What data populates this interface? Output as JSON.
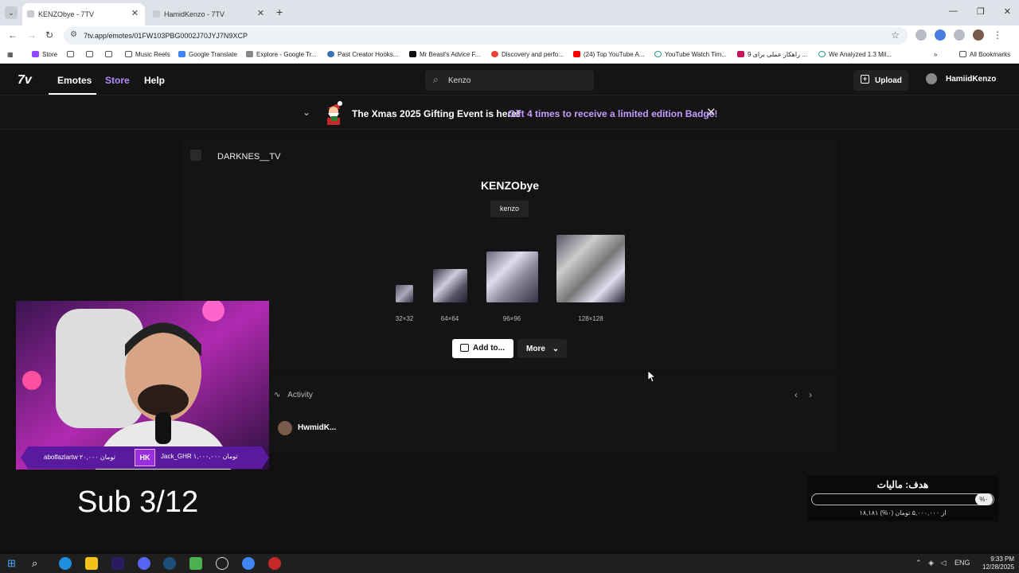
{
  "browser": {
    "tabs": [
      {
        "title": "KENZObye - 7TV",
        "active": true
      },
      {
        "title": "HamidKenzo - 7TV",
        "active": false
      }
    ],
    "url": "7tv.app/emotes/01FW103PBG0002J70JYJ7N9XCP",
    "bookmarks": [
      "Store",
      "",
      "",
      "Music Reels",
      "Google Translate",
      "Explore - Google Tr...",
      "Past Creator Hooks...",
      "Mr Beast's Advice F...",
      "Discovery and perfo...",
      "(24) Top YouTube A...",
      "YouTube Watch Tim...",
      "9 راهکار عملی برای ...",
      "We Analyzed 1.3 Mil...",
      "All Bookmarks"
    ]
  },
  "site": {
    "logo": "7v",
    "nav": {
      "emotes": "Emotes",
      "store": "Store",
      "help": "Help"
    },
    "search_value": "Kenzo",
    "upload_label": "Upload",
    "username": "HamiidKenzo",
    "banner": {
      "text": "The Xmas 2025 Gifting Event is here!",
      "link": "Gift 4 times to receive a limited edition Badge!"
    },
    "emote": {
      "owner": "DARKNES__TV",
      "name": "KENZObye",
      "tag": "kenzo",
      "sizes": [
        "32×32",
        "64×64",
        "96×96",
        "128×128"
      ],
      "add_label": "Add to...",
      "more_label": "More"
    },
    "activity": {
      "heading": "Activity",
      "user": "HwmidK..."
    }
  },
  "overlay": {
    "left_donor": "abolfazlartw ۲۰,۰۰۰ تومان",
    "right_donor": "Jack_GHR ۱,۰۰۰,۰۰۰ تومان",
    "badge": "HK",
    "sub_text": "Sub 3/12",
    "goal": {
      "title": "هدف: ماليات",
      "percent": "%۰",
      "progress": 0,
      "detail": "۱۸,۱۸۱ از ۵,۰۰۰,۰۰۰ تومان (۰%)"
    }
  },
  "taskbar": {
    "language": "ENG",
    "time": "9:33 PM",
    "date": "12/28/2025"
  },
  "colors": {
    "accent": "#b48cff",
    "banner_link": "#c59bff",
    "overlay_purple": "#5a1aa0"
  }
}
